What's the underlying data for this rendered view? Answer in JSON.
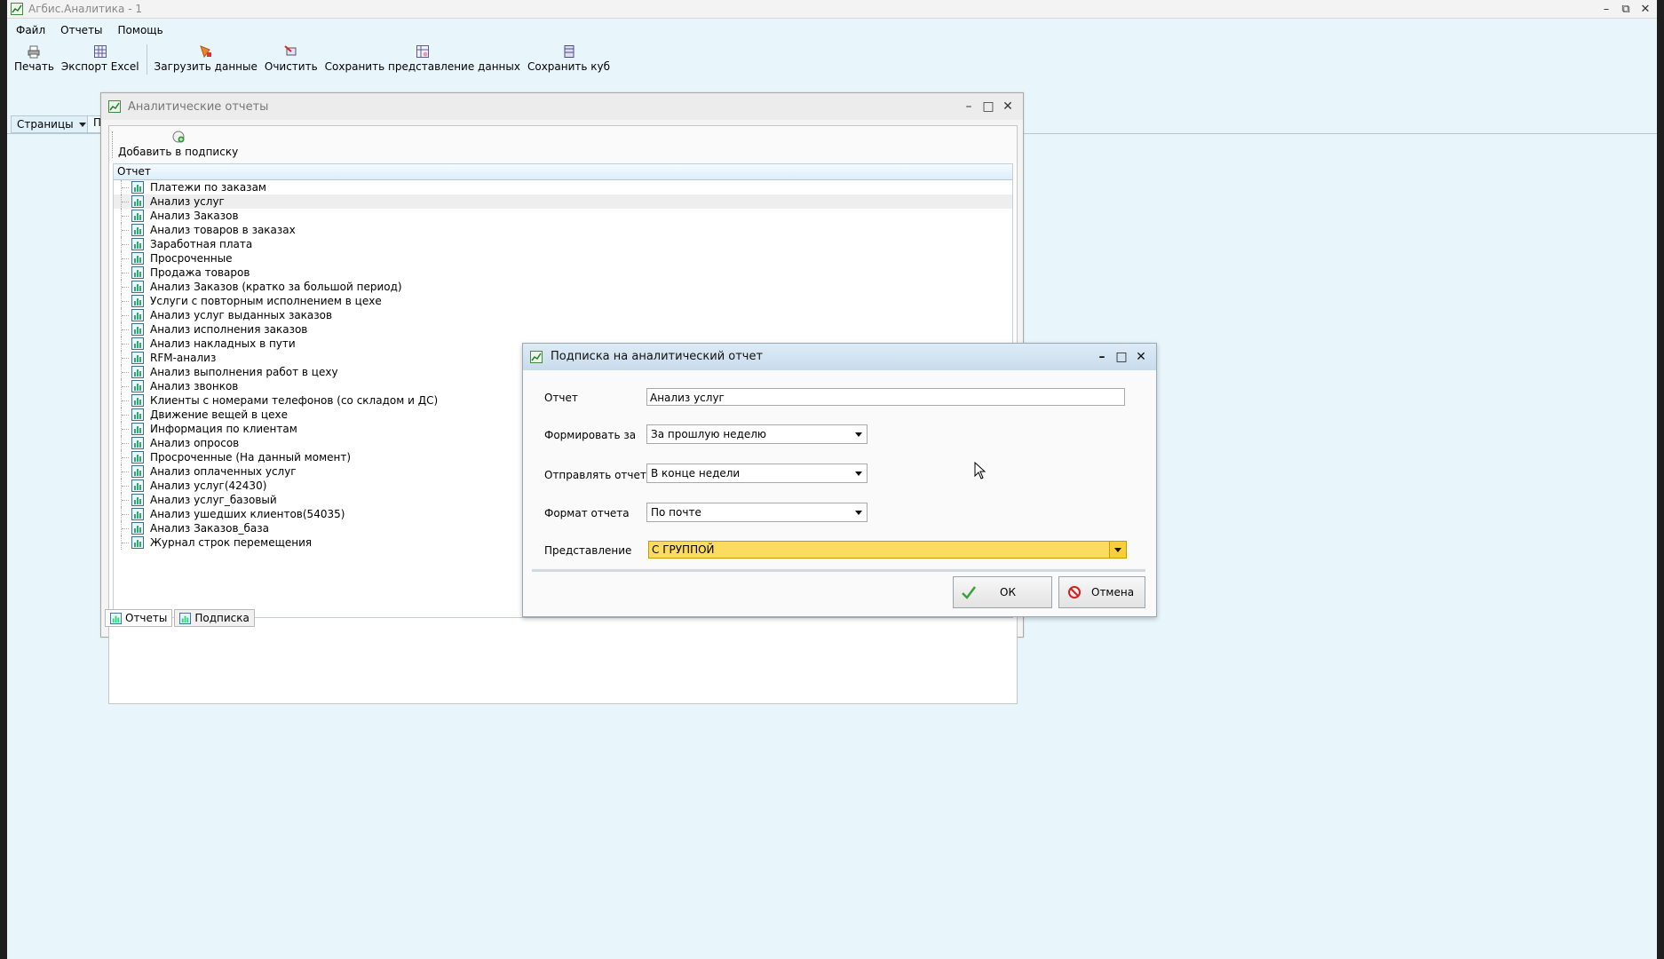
{
  "app": {
    "title": "Агбис.Аналитика - 1",
    "window_buttons": {
      "minimize": "–",
      "restore": "⧉",
      "close": "✕"
    }
  },
  "menu": [
    "Файл",
    "Отчеты",
    "Помощь"
  ],
  "toolbar": {
    "print": "Печать",
    "export_excel": "Экспорт Excel",
    "load_data": "Загрузить данные",
    "clear": "Очистить",
    "save_view": "Сохранить представление данных",
    "save_cube": "Сохранить куб"
  },
  "tabs": {
    "pages": "Страницы",
    "partial_tab": "П"
  },
  "reports_window": {
    "title": "Аналитические отчеты",
    "add_subscription": "Добавить в подписку",
    "column_header": "Отчет",
    "selected_index": 1,
    "reports": [
      "Платежи по заказам",
      "Анализ услуг",
      "Анализ Заказов",
      "Анализ товаров в заказах",
      "Заработная плата",
      "Просроченные",
      "Продажа товаров",
      "Анализ Заказов (кратко за большой период)",
      "Услуги с повторным исполнением в цехе",
      "Анализ услуг выданных заказов",
      "Анализ исполнения заказов",
      "Анализ накладных в пути",
      "RFM-анализ",
      "Анализ выполнения работ в цеху",
      "Анализ звонков",
      "Клиенты с номерами телефонов (со складом и ДС)",
      "Движение вещей в цехе",
      "Информация по клиентам",
      "Анализ опросов",
      "Просроченные (На данный момент)",
      "Анализ оплаченных услуг",
      "Анализ услуг(42430)",
      "Анализ услуг_базовый",
      "Анализ ушедших клиентов(54035)",
      "Анализ Заказов_база",
      "Журнал строк перемещения"
    ],
    "bottom_tabs": [
      "Отчеты",
      "Подписка"
    ]
  },
  "dialog": {
    "title": "Подписка на аналитический отчет",
    "report_label": "Отчет",
    "report_value": "Анализ услуг",
    "period_label": "Формировать за",
    "period_value": "За прошлую неделю",
    "send_label": "Отправлять отчет",
    "send_value": "В конце недели",
    "format_label": "Формат отчета",
    "format_value": "По почте",
    "view_label": "Представление",
    "view_value": "С ГРУППОЙ",
    "ok": "ОК",
    "cancel": "Отмена"
  },
  "colors": {
    "workspace": "#e8f6fc",
    "highlight": "#fbdc60",
    "dialog_title": "#c9dbec"
  }
}
